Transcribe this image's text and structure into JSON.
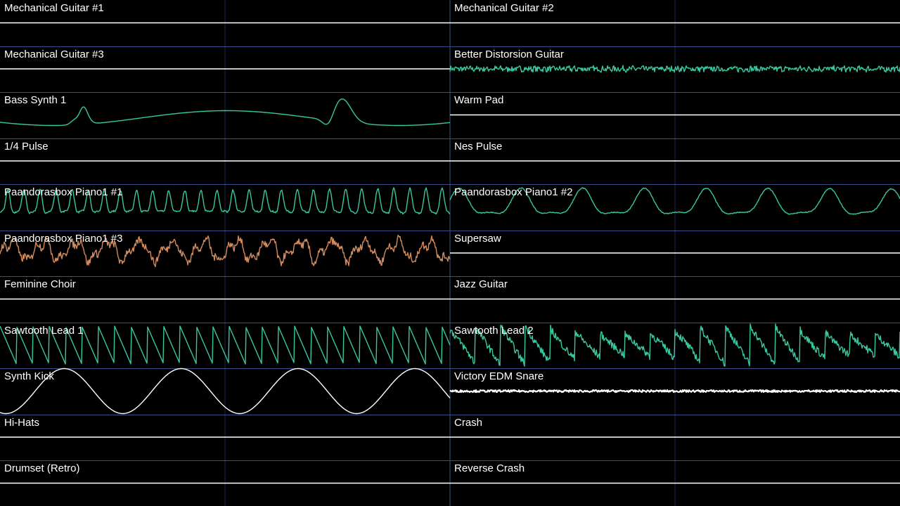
{
  "colors": {
    "background": "#000000",
    "separator": "#3a4f88",
    "center_line": "#1c2a44",
    "label": "#ffffff",
    "teal": "#38c79f",
    "orange": "#d38b5d",
    "white": "#ffffff"
  },
  "tracks": [
    {
      "name": "Mechanical Guitar #1",
      "wave": "flat",
      "color": "white"
    },
    {
      "name": "Mechanical Guitar #2",
      "wave": "flat",
      "color": "white"
    },
    {
      "name": "Mechanical Guitar #3",
      "wave": "flat",
      "color": "white"
    },
    {
      "name": "Better Distorsion Guitar",
      "wave": "noise",
      "color": "teal"
    },
    {
      "name": "Bass Synth 1",
      "wave": "bass",
      "color": "teal"
    },
    {
      "name": "Warm Pad",
      "wave": "flat",
      "color": "white"
    },
    {
      "name": "1/4 Pulse",
      "wave": "flat",
      "color": "white"
    },
    {
      "name": "Nes Pulse",
      "wave": "flat",
      "color": "white"
    },
    {
      "name": "Paandorasbox Piano1 #1",
      "wave": "piano",
      "color": "teal"
    },
    {
      "name": "Paandorasbox Piano1 #2",
      "wave": "piano-slow",
      "color": "teal"
    },
    {
      "name": "Paandorasbox Piano1 #3",
      "wave": "piano-rough",
      "color": "orange"
    },
    {
      "name": "Supersaw",
      "wave": "flat",
      "color": "white"
    },
    {
      "name": "Feminine Choir",
      "wave": "flat",
      "color": "white"
    },
    {
      "name": "Jazz Guitar",
      "wave": "flat",
      "color": "white"
    },
    {
      "name": "Sawtooth Lead 1",
      "wave": "saw",
      "color": "teal"
    },
    {
      "name": "Sawtooth Lead 2",
      "wave": "saw-rough",
      "color": "teal"
    },
    {
      "name": "Synth Kick",
      "wave": "kick",
      "color": "white"
    },
    {
      "name": "Victory EDM Snare",
      "wave": "snare-noise",
      "color": "white"
    },
    {
      "name": "Hi-Hats",
      "wave": "flat",
      "color": "white"
    },
    {
      "name": "Crash",
      "wave": "flat",
      "color": "white"
    },
    {
      "name": "Drumset (Retro)",
      "wave": "flat",
      "color": "white"
    },
    {
      "name": "Reverse Crash",
      "wave": "flat",
      "color": "white"
    }
  ]
}
